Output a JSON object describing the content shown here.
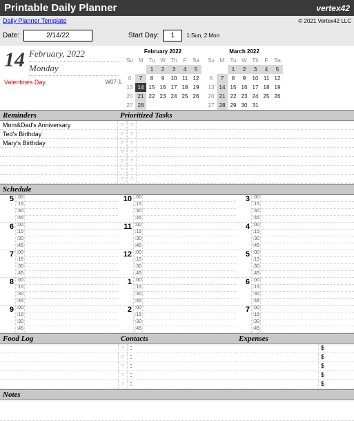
{
  "header": {
    "title": "Printable Daily Planner",
    "brand": "vertex42",
    "templateLink": "Daily Planner Template",
    "copyright": "© 2021 Vertex42 LLC"
  },
  "inputs": {
    "dateLabel": "Date:",
    "dateValue": "2/14/22",
    "startDayLabel": "Start Day:",
    "startDayValue": "1",
    "startDayHint": "1:Sun, 2:Mon"
  },
  "day": {
    "number": "14",
    "monthYear": "February, 2022",
    "dow": "Monday",
    "holiday": "Valentines Day",
    "week": "W07-1"
  },
  "cal1": {
    "title": "February 2022",
    "dh": [
      "Su",
      "M",
      "Tu",
      "W",
      "Th",
      "F",
      "Sa"
    ],
    "rows": [
      [
        "",
        "",
        "1",
        "2",
        "3",
        "4",
        "5"
      ],
      [
        "6",
        "7",
        "8",
        "9",
        "10",
        "11",
        "12"
      ],
      [
        "13",
        "14",
        "15",
        "16",
        "17",
        "18",
        "19"
      ],
      [
        "20",
        "21",
        "22",
        "23",
        "24",
        "25",
        "26"
      ],
      [
        "27",
        "28",
        "",
        "",
        "",
        "",
        ""
      ]
    ]
  },
  "cal2": {
    "title": "March 2022",
    "dh": [
      "Su",
      "M",
      "Tu",
      "W",
      "Th",
      "F",
      "Sa"
    ],
    "rows": [
      [
        "",
        "",
        "1",
        "2",
        "3",
        "4",
        "5"
      ],
      [
        "6",
        "7",
        "8",
        "9",
        "10",
        "11",
        "12"
      ],
      [
        "13",
        "14",
        "15",
        "16",
        "17",
        "18",
        "19"
      ],
      [
        "20",
        "21",
        "22",
        "23",
        "24",
        "25",
        "26"
      ],
      [
        "27",
        "28",
        "29",
        "30",
        "31",
        "",
        ""
      ]
    ]
  },
  "sections": {
    "reminders": "Reminders",
    "tasks": "Prioritized Tasks",
    "schedule": "Schedule",
    "food": "Food Log",
    "contacts": "Contacts",
    "expenses": "Expenses",
    "notes": "Notes"
  },
  "reminders": [
    "Mom&Dad's Anniversary",
    "Ted's Birthday",
    "Mary's Birthday",
    "",
    "",
    "",
    ""
  ],
  "tasks": [
    "",
    "",
    "",
    "",
    "",
    "",
    ""
  ],
  "schedule": {
    "col1": [
      "5",
      "6",
      "7",
      "8",
      "9"
    ],
    "col2": [
      "10",
      "11",
      "12",
      "1",
      "2"
    ],
    "col3": [
      "3",
      "4",
      "5",
      "6",
      "7"
    ],
    "mins": [
      ":00",
      ":15",
      ":30",
      ":45"
    ]
  },
  "food": [
    "",
    "",
    "",
    "",
    ""
  ],
  "contacts": [
    "",
    "",
    "",
    "",
    ""
  ],
  "expenses": [
    "",
    "",
    "",
    "",
    ""
  ],
  "symbols": {
    "check": "○",
    "colon": ":",
    "dollar": "$"
  }
}
